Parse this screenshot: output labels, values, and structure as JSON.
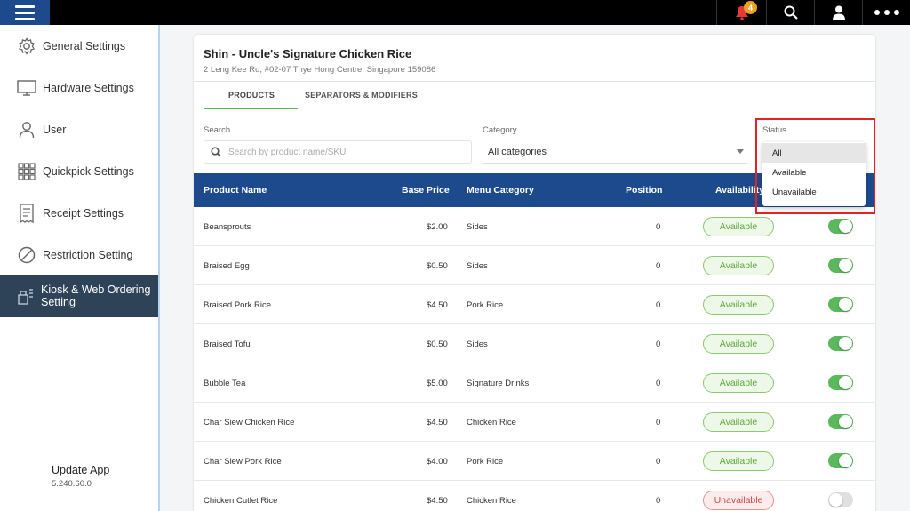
{
  "topbar": {
    "notification_count": "4"
  },
  "sidebar": {
    "items": [
      {
        "label": "General Settings",
        "icon": "gear-icon"
      },
      {
        "label": "Hardware Settings",
        "icon": "monitor-icon"
      },
      {
        "label": "User",
        "icon": "user-icon"
      },
      {
        "label": "Quickpick Settings",
        "icon": "grid-icon"
      },
      {
        "label": "Receipt Settings",
        "icon": "receipt-icon"
      },
      {
        "label": "Restriction Setting",
        "icon": "restriction-icon"
      },
      {
        "label": "Kiosk & Web Ordering Setting",
        "icon": "kiosk-icon"
      }
    ],
    "update_title": "Update App",
    "version": "5.240.60.0"
  },
  "store": {
    "name": "Shin - Uncle's Signature Chicken Rice",
    "address": "2 Leng Kee Rd, #02-07 Thye Hong Centre, Singapore 159086"
  },
  "tabs": [
    "PRODUCTS",
    "SEPARATORS & MODIFIERS"
  ],
  "filters": {
    "search_label": "Search",
    "search_placeholder": "Search by product name/SKU",
    "category_label": "Category",
    "category_value": "All categories",
    "status_label": "Status",
    "status_options": [
      "All",
      "Available",
      "Unavailable"
    ],
    "status_selected": "All"
  },
  "table": {
    "headers": [
      "Product Name",
      "Base Price",
      "Menu Category",
      "Position",
      "Availability"
    ],
    "rows": [
      {
        "name": "Beansprouts",
        "price": "$2.00",
        "category": "Sides",
        "position": "0",
        "availability": "Available",
        "enabled": true
      },
      {
        "name": "Braised Egg",
        "price": "$0.50",
        "category": "Sides",
        "position": "0",
        "availability": "Available",
        "enabled": true
      },
      {
        "name": "Braised Pork Rice",
        "price": "$4.50",
        "category": "Pork Rice",
        "position": "0",
        "availability": "Available",
        "enabled": true
      },
      {
        "name": "Braised Tofu",
        "price": "$0.50",
        "category": "Sides",
        "position": "0",
        "availability": "Available",
        "enabled": true
      },
      {
        "name": "Bubble Tea",
        "price": "$5.00",
        "category": "Signature Drinks",
        "position": "0",
        "availability": "Available",
        "enabled": true
      },
      {
        "name": "Char Siew Chicken Rice",
        "price": "$4.50",
        "category": "Chicken Rice",
        "position": "0",
        "availability": "Available",
        "enabled": true
      },
      {
        "name": "Char Siew Pork Rice",
        "price": "$4.00",
        "category": "Pork Rice",
        "position": "0",
        "availability": "Available",
        "enabled": true
      },
      {
        "name": "Chicken Cutlet Rice",
        "price": "$4.50",
        "category": "Chicken Rice",
        "position": "0",
        "availability": "Unavailable",
        "enabled": false
      }
    ]
  },
  "colors": {
    "primary": "#1c4a8c",
    "sidebar_active": "#2f4358",
    "accent_green": "#5cb85c",
    "highlight_red": "#e02424",
    "badge_orange": "#f0a020"
  }
}
